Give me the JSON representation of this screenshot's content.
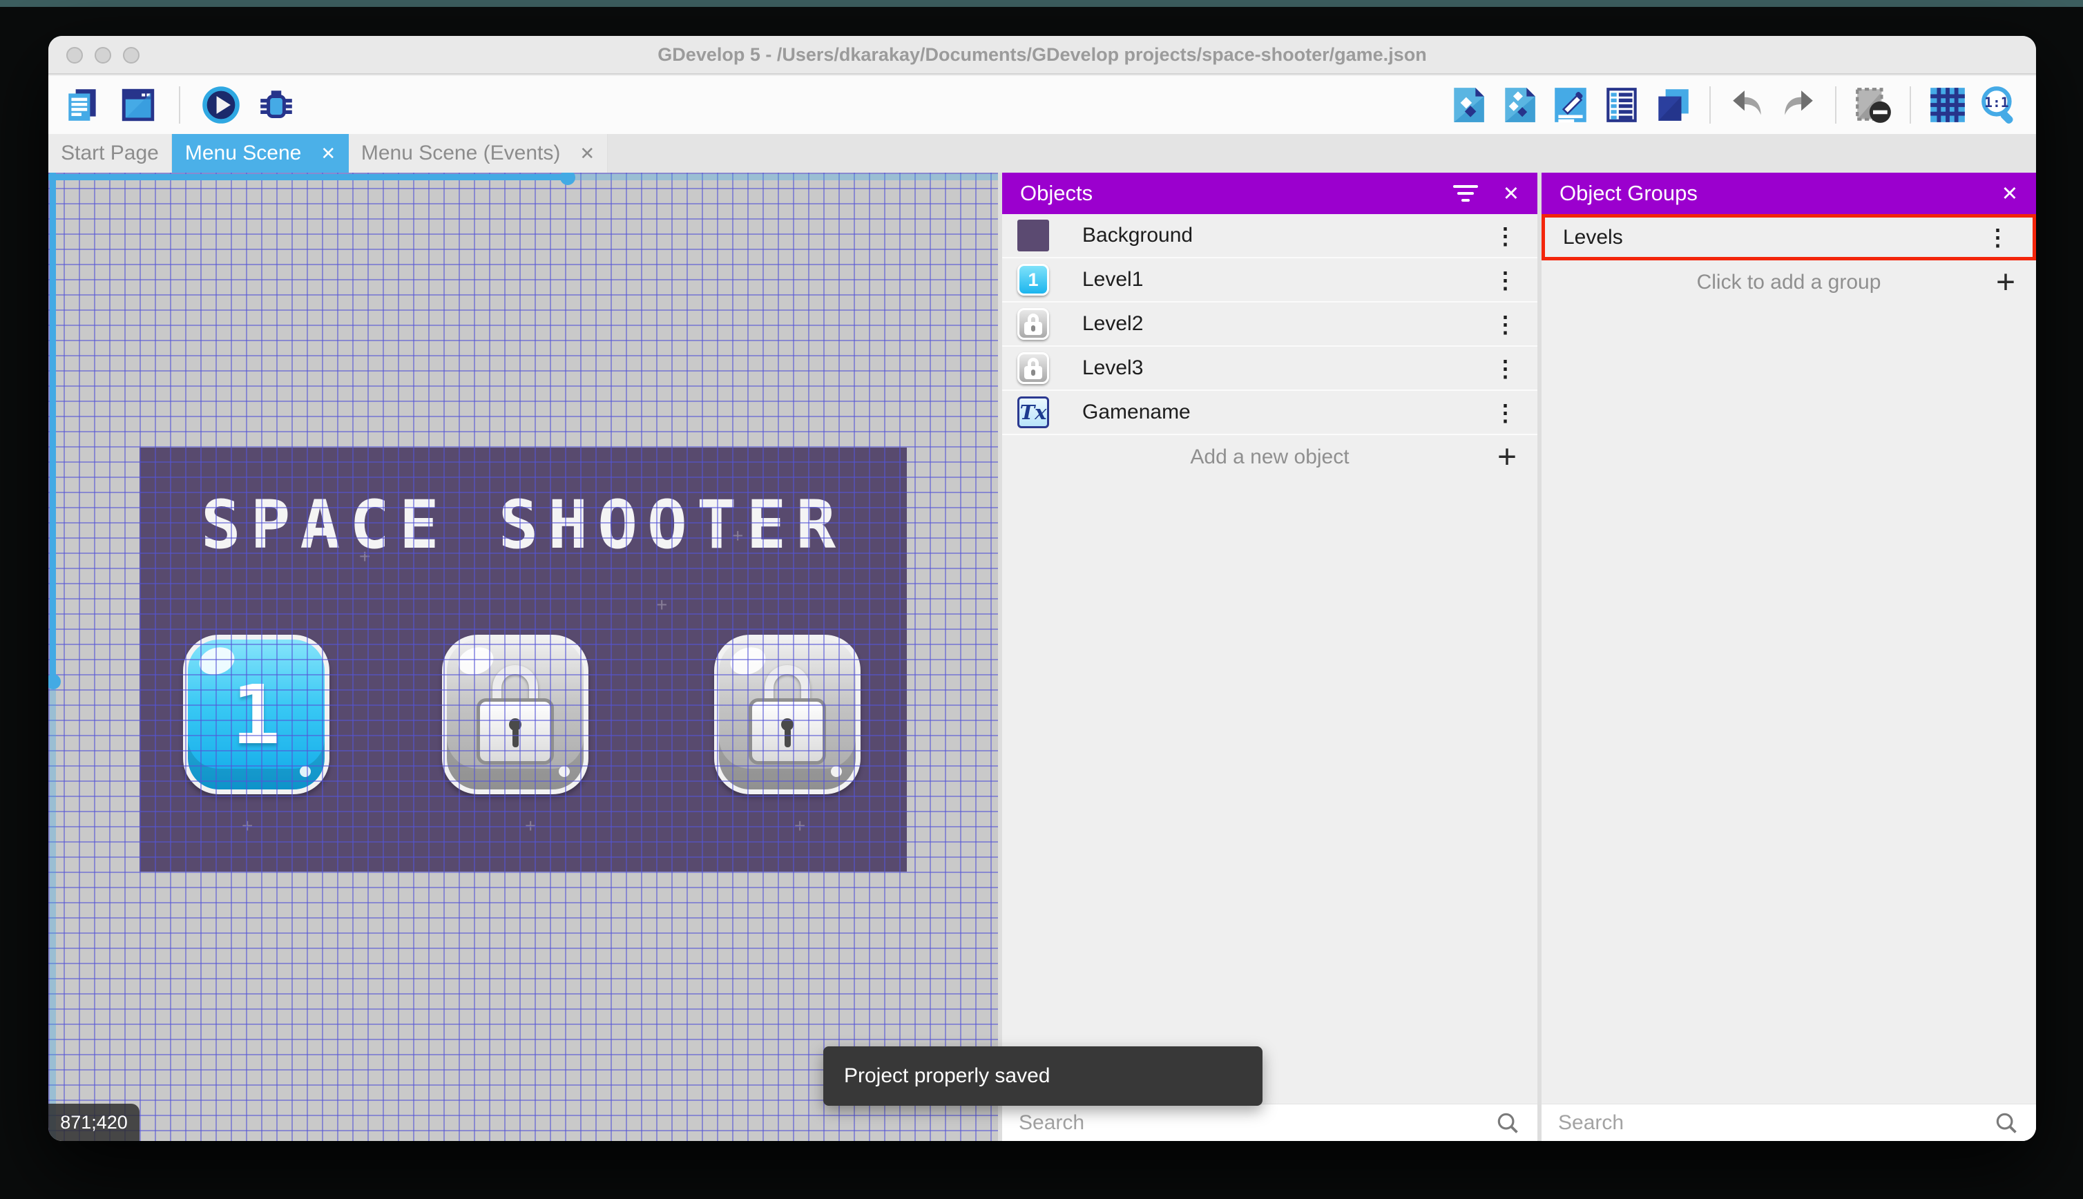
{
  "window": {
    "title": "GDevelop 5 - /Users/dkarakay/Documents/GDevelop projects/space-shooter/game.json"
  },
  "tabs": {
    "start": "Start Page",
    "scene": "Menu Scene",
    "events": "Menu Scene (Events)"
  },
  "icons": {
    "close": "✕",
    "more": "⋮",
    "add": "+",
    "star": "+"
  },
  "canvas": {
    "coordinates": "871;420"
  },
  "scene": {
    "title": "SPACE SHOOTER",
    "level1_label": "1"
  },
  "objects_panel": {
    "title": "Objects",
    "items": [
      {
        "name": "Background"
      },
      {
        "name": "Level1",
        "badge": "1"
      },
      {
        "name": "Level2"
      },
      {
        "name": "Level3"
      },
      {
        "name": "Gamename",
        "badge": "Tx"
      }
    ],
    "add_label": "Add a new object",
    "search_placeholder": "Search"
  },
  "groups_panel": {
    "title": "Object Groups",
    "groups": [
      {
        "name": "Levels"
      }
    ],
    "add_label": "Click to add a group",
    "search_placeholder": "Search"
  },
  "toast": {
    "message": "Project properly saved"
  },
  "colors": {
    "accent_purple": "#9b00ce",
    "active_tab_blue": "#4bb0e8",
    "highlight_red": "#f3250b"
  }
}
